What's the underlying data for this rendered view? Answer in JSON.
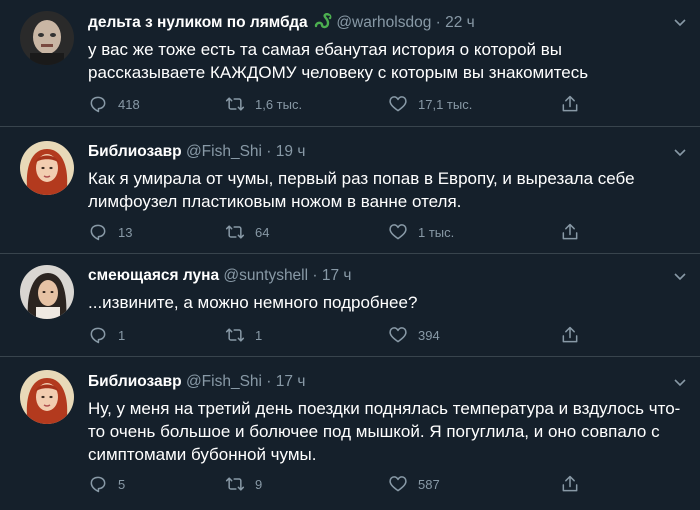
{
  "tweets": [
    {
      "name": "дельта з нуликом по лямбда",
      "name_emoji": "snake-emoji",
      "handle": "@warholsdog",
      "time": "22 ч",
      "text": "у вас же тоже есть та самая ебанутая история о которой вы рассказываете КАЖДОМУ человеку с которым вы знакомитесь",
      "replies": "418",
      "retweets": "1,6 тыс.",
      "likes": "17,1 тыс."
    },
    {
      "name": "Библиозавр",
      "handle": "@Fish_Shi",
      "time": "19 ч",
      "text": "Как я умирала от чумы, первый раз попав в Европу, и вырезала себе лимфоузел пластиковым ножом в ванне отеля.",
      "replies": "13",
      "retweets": "64",
      "likes": "1 тыс."
    },
    {
      "name": "смеющаяся луна",
      "handle": "@suntyshell",
      "time": "17 ч",
      "text": "...извините, а можно немного подробнее?",
      "replies": "1",
      "retweets": "1",
      "likes": "394"
    },
    {
      "name": "Библиозавр",
      "handle": "@Fish_Shi",
      "time": "17 ч",
      "text": "Ну, у меня на третий день поездки поднялась температура и вздулось что-то очень большое и болючее под мышкой. Я погуглила, и оно совпало с симптомами бубонной чумы.",
      "replies": "5",
      "retweets": "9",
      "likes": "587"
    }
  ],
  "separator": "·",
  "colors": {
    "background": "#15202b",
    "secondary_text": "#8899a6",
    "divider": "#38444d",
    "emoji_green": "#4caf50"
  }
}
